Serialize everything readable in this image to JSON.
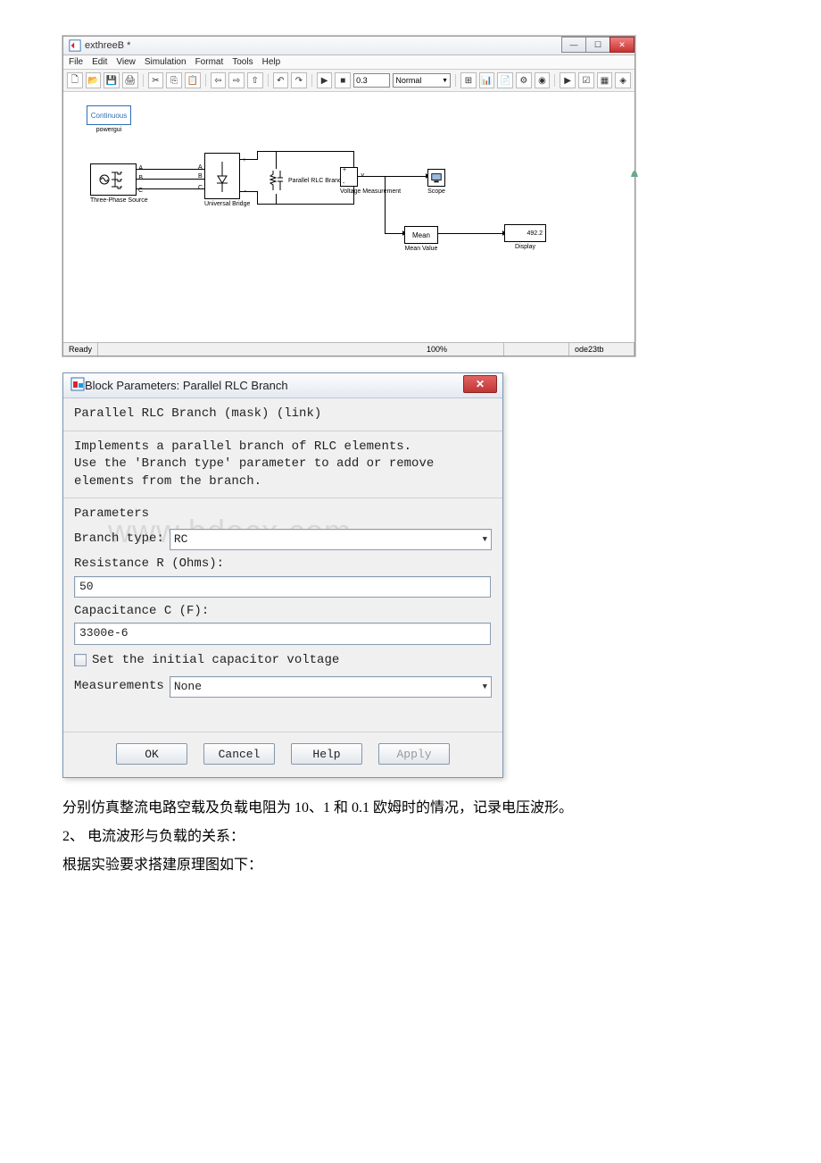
{
  "sim": {
    "title": "exthreeB *",
    "menu": {
      "file": "File",
      "edit": "Edit",
      "view": "View",
      "simulation": "Simulation",
      "format": "Format",
      "tools": "Tools",
      "help": "Help"
    },
    "stop_time": "0.3",
    "mode": "Normal",
    "status": {
      "ready": "Ready",
      "zoom": "100%",
      "solver": "ode23tb"
    },
    "blocks": {
      "powergui_text": "Continuous",
      "powergui_label": "powergui",
      "three_phase_label": "Three-Phase Source",
      "universal_label": "Universal Bridge",
      "rlc_label": "Parallel RLC Branch",
      "vmeas_label": "Voltage Measurement",
      "scope_label": "Scope",
      "mean_center": "Mean",
      "mean_label": "Mean Value",
      "display_val": "492.2",
      "display_label": "Display",
      "port_a": "A",
      "port_b": "B",
      "port_c": "C",
      "port_plus": "+",
      "port_minus": "-",
      "port_v": "v"
    }
  },
  "dialog": {
    "title": "Block Parameters: Parallel RLC Branch",
    "head_line": "Parallel RLC Branch (mask) (link)",
    "desc1": "Implements a parallel branch of RLC elements.",
    "desc2": "Use the 'Branch type' parameter to add or remove elements from the branch.",
    "params_label": "Parameters",
    "branch_type_label": "Branch type:",
    "branch_type_value": "RC",
    "res_label": "Resistance R (Ohms):",
    "res_value": "50",
    "cap_label": "Capacitance C (F):",
    "cap_value": "3300e-6",
    "set_init_label": "Set the initial capacitor voltage",
    "measurements_label": "Measurements",
    "measurements_value": "None",
    "btn_ok": "OK",
    "btn_cancel": "Cancel",
    "btn_help": "Help",
    "btn_apply": "Apply"
  },
  "watermark": "www.bdocx.com",
  "cn": {
    "line1": "分别仿真整流电路空载及负载电阻为 10、1 和 0.1 欧姆时的情况，记录电压波形。",
    "line2": "2、 电流波形与负载的关系：",
    "line3": " 根据实验要求搭建原理图如下："
  }
}
